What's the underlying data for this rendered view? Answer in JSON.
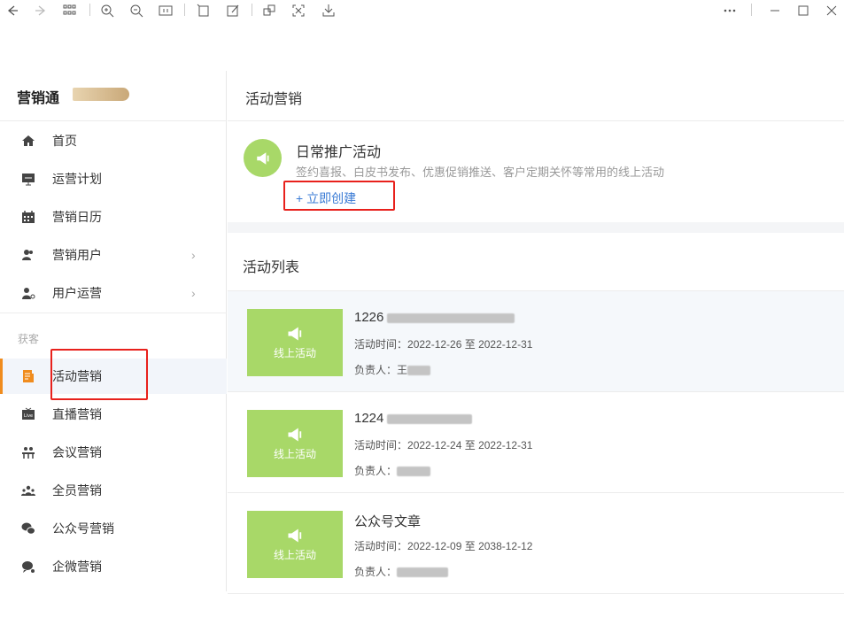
{
  "toolbar": {
    "icons": [
      "back-icon",
      "forward-icon",
      "grid-icon",
      "zoom-in-icon",
      "zoom-out-icon",
      "fit-icon",
      "rotate-icon",
      "edit-icon",
      "copy-icon",
      "fullscreen-icon",
      "download-icon",
      "more-icon",
      "minimize-icon",
      "maximize-icon",
      "close-icon"
    ]
  },
  "sidebar": {
    "brand": "营销通",
    "group_label": "获客",
    "items": [
      {
        "label": "首页",
        "icon": "home-icon"
      },
      {
        "label": "运营计划",
        "icon": "plan-icon"
      },
      {
        "label": "营销日历",
        "icon": "calendar-icon"
      },
      {
        "label": "营销用户",
        "icon": "users-icon",
        "chevron": "›"
      },
      {
        "label": "用户运营",
        "icon": "user-ops-icon",
        "chevron": "›"
      },
      {
        "label": "活动营销",
        "icon": "activity-icon",
        "active": true
      },
      {
        "label": "直播营销",
        "icon": "live-icon"
      },
      {
        "label": "会议营销",
        "icon": "meeting-icon"
      },
      {
        "label": "全员营销",
        "icon": "team-icon"
      },
      {
        "label": "公众号营销",
        "icon": "wechat-icon"
      },
      {
        "label": "企微营销",
        "icon": "wework-icon"
      }
    ]
  },
  "main": {
    "title": "活动营销",
    "promo": {
      "title": "日常推广活动",
      "desc": "签约喜报、白皮书发布、优惠促销推送、客户定期关怀等常用的线上活动",
      "create_label": "+ 立即创建"
    },
    "list_title": "活动列表",
    "activities": [
      {
        "name": "1226",
        "thumb_label": "线上活动",
        "time_label": "活动时间：",
        "time": "2022-12-26 至 2022-12-31",
        "owner_label": "负责人：",
        "owner": "王"
      },
      {
        "name": "1224",
        "thumb_label": "线上活动",
        "time_label": "活动时间：",
        "time": "2022-12-24 至 2022-12-31",
        "owner_label": "负责人：",
        "owner": ""
      },
      {
        "name": "公众号文章",
        "thumb_label": "线上活动",
        "time_label": "活动时间：",
        "time": "2022-12-09 至 2038-12-12",
        "owner_label": "负责人：",
        "owner": ""
      }
    ]
  },
  "colors": {
    "accent": "#f08c1e",
    "link": "#3a7bd5",
    "thumb": "#a8d868",
    "highlight_box": "#e8211c"
  }
}
